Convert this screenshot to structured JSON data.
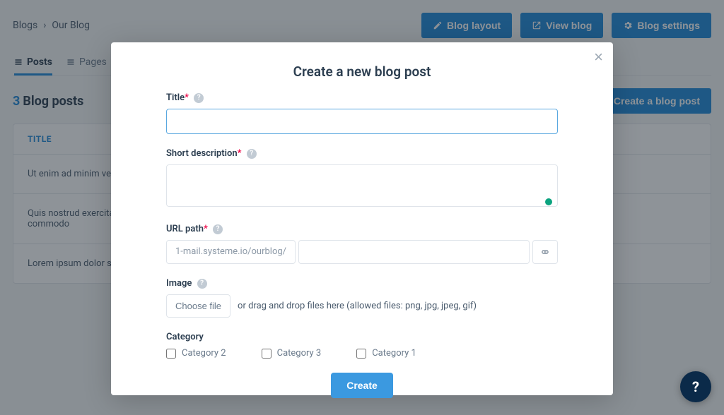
{
  "breadcrumb": {
    "root": "Blogs",
    "current": "Our Blog"
  },
  "header_buttons": {
    "layout": "Blog layout",
    "view": "View blog",
    "settings": "Blog settings"
  },
  "tabs": {
    "posts": "Posts",
    "pages": "Pages"
  },
  "posts": {
    "count": "3",
    "label": "Blog posts",
    "create_button": "Create a blog post",
    "table_header": "TITLE",
    "rows": [
      "Ut enim ad minim ven",
      "Quis nostrud exercita\ncommodo",
      "Lorem ipsum dolor sit"
    ]
  },
  "modal": {
    "title": "Create a new blog post",
    "fields": {
      "title": {
        "label": "Title"
      },
      "short_desc": {
        "label": "Short description"
      },
      "url_path": {
        "label": "URL path",
        "prefix": "1-mail.systeme.io/ourblog/"
      },
      "image": {
        "label": "Image",
        "button": "Choose file",
        "hint": "or drag and drop files here (allowed files: png, jpg, jpeg, gif)"
      },
      "category": {
        "label": "Category",
        "options": [
          "Category 2",
          "Category 3",
          "Category 1"
        ]
      }
    },
    "create_button": "Create"
  },
  "help_fab": "?"
}
